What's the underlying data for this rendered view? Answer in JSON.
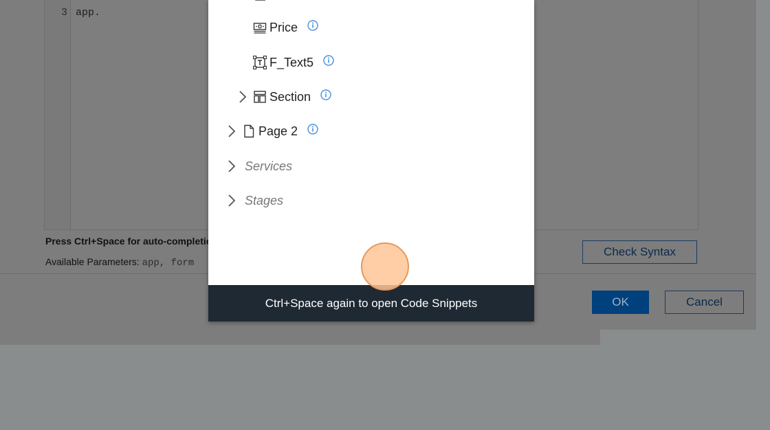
{
  "editor": {
    "line_number": "3",
    "line_code": "app.",
    "hint": "Press Ctrl+Space for auto-completion",
    "params_label": "Available Parameters:",
    "params_values": "app, form"
  },
  "buttons": {
    "check_syntax": "Check Syntax",
    "ok": "OK",
    "cancel": "Cancel"
  },
  "tree": {
    "items": [
      {
        "label": "Price",
        "icon": "currency-field-icon",
        "info": true
      },
      {
        "label": "F_Text5",
        "icon": "text-field-icon",
        "info": true
      },
      {
        "label": "Section",
        "icon": "section-icon",
        "info": true,
        "expandable": true
      },
      {
        "label": "Page 2",
        "icon": "page-icon",
        "info": true,
        "expandable": true
      },
      {
        "label": "Services",
        "italic": true,
        "expandable": true
      },
      {
        "label": "Stages",
        "italic": true,
        "expandable": true
      }
    ]
  },
  "footer": {
    "text": "Ctrl+Space again to open Code Snippets"
  },
  "colors": {
    "accent": "#00407c",
    "footer_bg": "#1f2933",
    "info_icon": "#4a90d9"
  }
}
